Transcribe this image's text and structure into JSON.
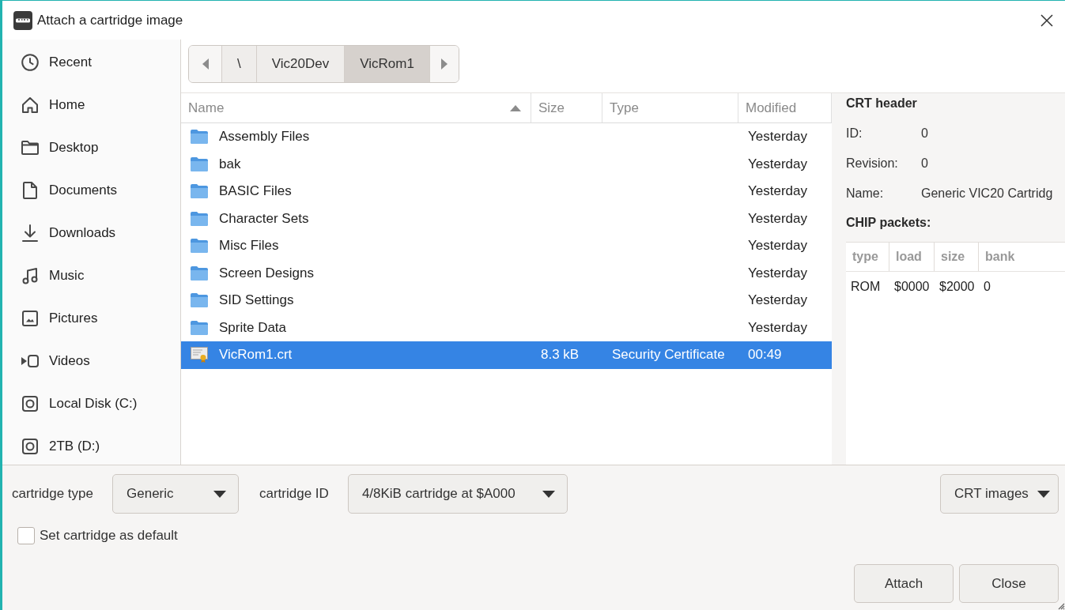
{
  "window": {
    "title": "Attach a cartridge image"
  },
  "sidebar": {
    "items": [
      {
        "kind": "recent",
        "label": "Recent"
      },
      {
        "kind": "home",
        "label": "Home"
      },
      {
        "kind": "folder",
        "label": "Desktop"
      },
      {
        "kind": "document",
        "label": "Documents"
      },
      {
        "kind": "download",
        "label": "Downloads"
      },
      {
        "kind": "music",
        "label": "Music"
      },
      {
        "kind": "picture",
        "label": "Pictures"
      },
      {
        "kind": "video",
        "label": "Videos"
      },
      {
        "kind": "drive",
        "label": "Local Disk (C:)"
      },
      {
        "kind": "drive",
        "label": "2TB (D:)"
      }
    ]
  },
  "path_bar": {
    "segments": [
      {
        "label": "\\",
        "selected": false
      },
      {
        "label": "Vic20Dev",
        "selected": false
      },
      {
        "label": "VicRom1",
        "selected": true
      }
    ]
  },
  "file_list": {
    "columns": [
      {
        "label": "Name",
        "sorted": true
      },
      {
        "label": "Size",
        "sorted": false
      },
      {
        "label": "Type",
        "sorted": false
      },
      {
        "label": "Modified",
        "sorted": false
      }
    ],
    "rows": [
      {
        "kind": "folder",
        "name": "Assembly Files",
        "modified": "Yesterday",
        "selected": false
      },
      {
        "kind": "folder",
        "name": "bak",
        "modified": "Yesterday",
        "selected": false
      },
      {
        "kind": "folder",
        "name": "BASIC Files",
        "modified": "Yesterday",
        "selected": false
      },
      {
        "kind": "folder",
        "name": "Character Sets",
        "modified": "Yesterday",
        "selected": false
      },
      {
        "kind": "folder",
        "name": "Misc Files",
        "modified": "Yesterday",
        "selected": false
      },
      {
        "kind": "folder",
        "name": "Screen Designs",
        "modified": "Yesterday",
        "selected": false
      },
      {
        "kind": "folder",
        "name": "SID Settings",
        "modified": "Yesterday",
        "selected": false
      },
      {
        "kind": "folder",
        "name": "Sprite Data",
        "modified": "Yesterday",
        "selected": false
      },
      {
        "kind": "file",
        "name": "VicRom1.crt",
        "size": "8.3 kB",
        "type": "Security Certificate",
        "modified": "00:49",
        "selected": true
      }
    ]
  },
  "preview": {
    "title": "CRT header",
    "fields": [
      {
        "label": "ID:",
        "value": "0"
      },
      {
        "label": "Revision:",
        "value": "0"
      },
      {
        "label": "Name:",
        "value": "Generic VIC20 Cartridg"
      }
    ],
    "chip_title": "CHIP packets:",
    "chip_table": {
      "columns": [
        "type",
        "load",
        "size",
        "bank"
      ],
      "rows": [
        [
          "ROM",
          "$0000",
          "$2000",
          "0"
        ]
      ]
    }
  },
  "options": {
    "cartridge_type": {
      "label": "cartridge type",
      "value": "Generic"
    },
    "cartridge_id": {
      "label": "cartridge ID",
      "value": "4/8KiB cartridge at $A000"
    },
    "filter": {
      "value": "CRT images"
    },
    "default_checkbox": {
      "label": "Set cartridge as default",
      "checked": false
    }
  },
  "buttons": [
    {
      "label": "Attach"
    },
    {
      "label": "Close"
    }
  ]
}
